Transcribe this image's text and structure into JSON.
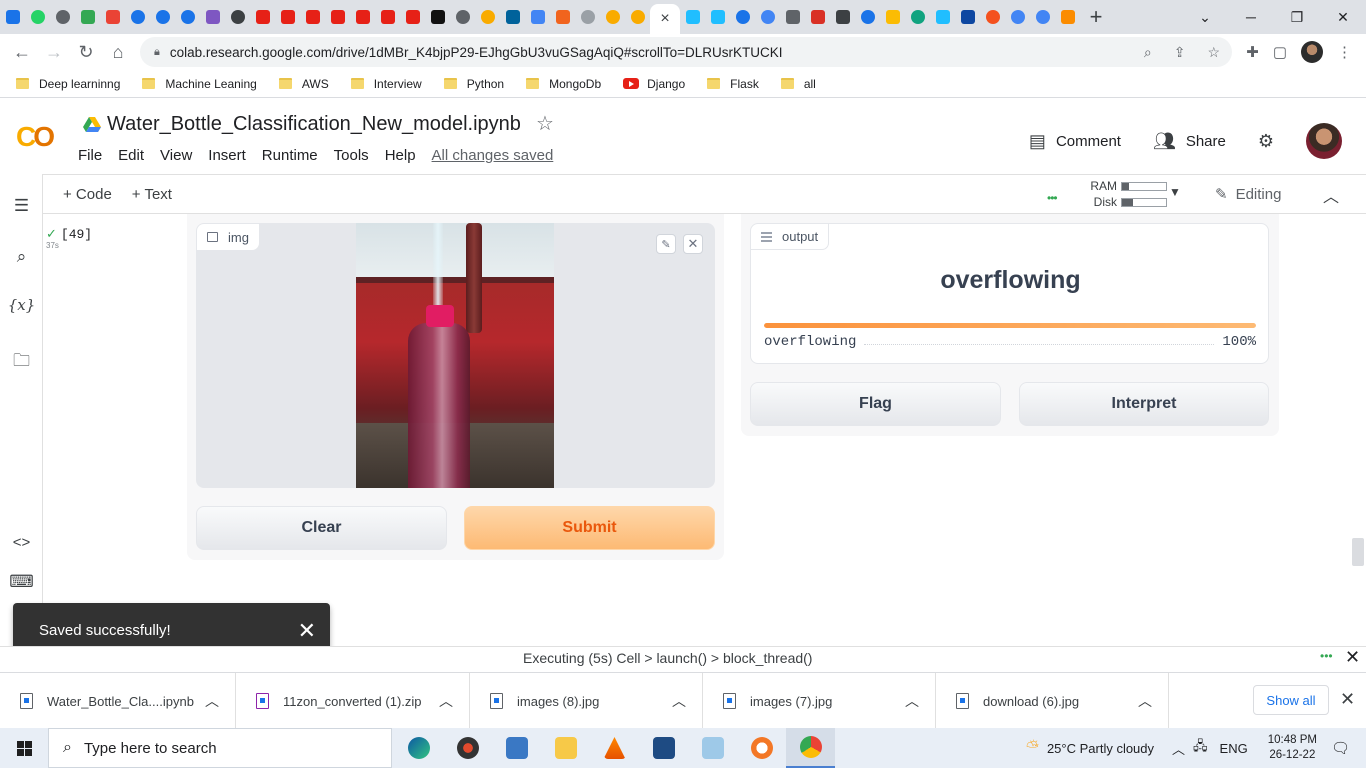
{
  "browser": {
    "active_tab_close": "×",
    "new_tab": "+",
    "url": "colab.research.google.com/drive/1dMBr_K4bjpP29-EJhgGbU3vuGSagAqiQ#scrollTo=DLRUsrKTUCKI",
    "bookmarks": [
      "Deep learninng",
      "Machine Leaning",
      "AWS",
      "Interview",
      "Python",
      "MongoDb",
      "Django",
      "Flask",
      "all"
    ]
  },
  "colab": {
    "notebook_title": "Water_Bottle_Classification_New_model.ipynb",
    "menu": [
      "File",
      "Edit",
      "View",
      "Insert",
      "Runtime",
      "Tools",
      "Help"
    ],
    "save_status": "All changes saved",
    "comment_label": "Comment",
    "share_label": "Share",
    "add_code": "+ Code",
    "add_text": "+ Text",
    "ram_label": "RAM",
    "disk_label": "Disk",
    "ram_usage": 0.15,
    "disk_usage": 0.25,
    "editing_label": "Editing",
    "cell_exec_count": "[49]",
    "cell_exec_time": "37s"
  },
  "gradio": {
    "input_label": "img",
    "clear_label": "Clear",
    "submit_label": "Submit",
    "output_label": "output",
    "prediction": "overflowing",
    "confidence_class": "overflowing",
    "confidence_pct": "100%",
    "confidence_value": 1.0,
    "flag_label": "Flag",
    "interpret_label": "Interpret"
  },
  "toast": {
    "message": "Saved successfully!"
  },
  "status": {
    "text": "Executing (5s)  Cell > launch() > block_thread()"
  },
  "downloads": {
    "items": [
      {
        "name": "Water_Bottle_Cla....ipynb"
      },
      {
        "name": "11zon_converted (1).zip"
      },
      {
        "name": "images (8).jpg"
      },
      {
        "name": "images (7).jpg"
      },
      {
        "name": "download (6).jpg"
      }
    ],
    "show_all": "Show all"
  },
  "taskbar": {
    "search_placeholder": "Type here to search",
    "weather": "25°C  Partly cloudy",
    "language": "ENG",
    "time": "10:48 PM",
    "date": "26-12-22"
  },
  "colors": {
    "colab_orange": "#f9ab00",
    "submit_orange": "#ea580c",
    "confidence_bar": "#fb923c"
  }
}
